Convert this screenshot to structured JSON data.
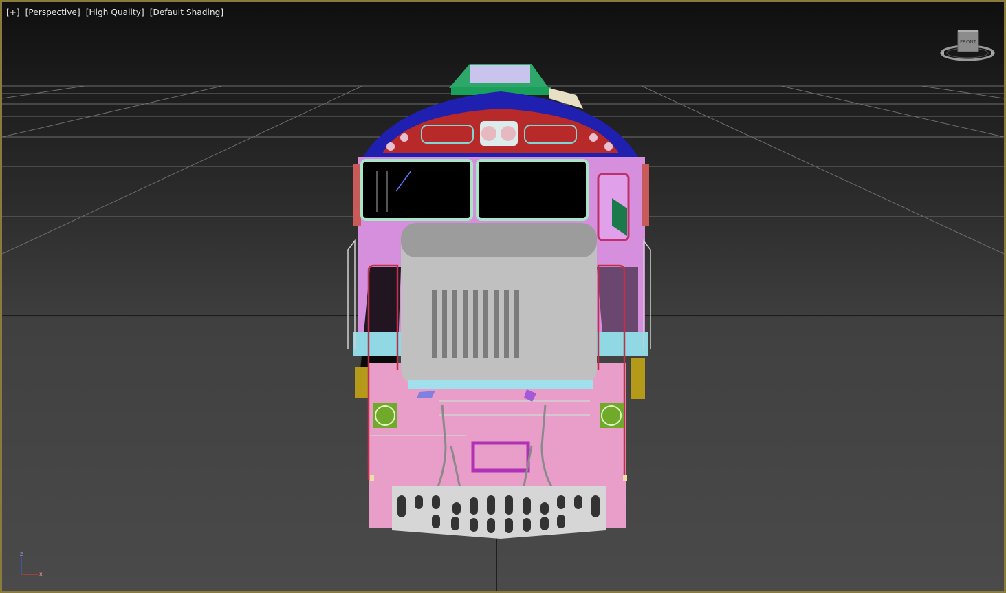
{
  "viewport": {
    "labels": {
      "menu": "[+]",
      "view": "[Perspective]",
      "quality": "[High Quality]",
      "shading": "[Default Shading]"
    },
    "viewcube": {
      "face_label": "FRONT"
    },
    "axis_tripod": {
      "z": "z",
      "x": "x"
    }
  },
  "colors": {
    "frame_border": "#8a7a3c",
    "body_pink": "#e89ec8",
    "cab_violet": "#d58fdc",
    "hood_grey": "#bfbfbf",
    "roof_blue": "#1f1fb0",
    "nose_red": "#b82a2a",
    "green_light": "#6faa2a",
    "cyan_trim": "#9fe0ec"
  }
}
